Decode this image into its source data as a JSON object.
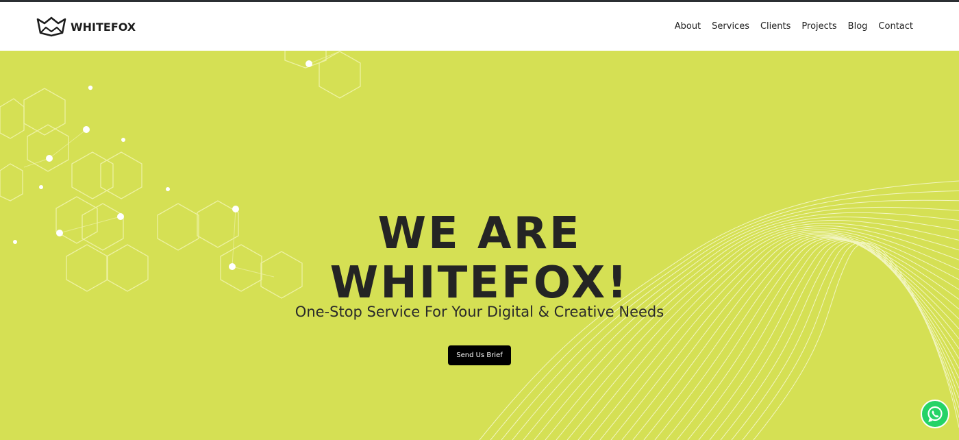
{
  "header": {
    "logo_text": "WHITEFOX",
    "nav": [
      {
        "label": "About"
      },
      {
        "label": "Services"
      },
      {
        "label": "Clients"
      },
      {
        "label": "Projects"
      },
      {
        "label": "Blog"
      },
      {
        "label": "Contact"
      }
    ]
  },
  "hero": {
    "title_line1": "WE ARE",
    "title_line2": "WHITEFOX!",
    "subtitle": "One-Stop Service For Your Digital & Creative Needs",
    "cta_label": "Send Us Brief",
    "background_color": "#d5e054"
  },
  "floating": {
    "whatsapp_icon": "whatsapp-icon",
    "whatsapp_color": "#25d366"
  },
  "colors": {
    "text_dark": "#242424",
    "button_bg": "#000000",
    "button_text": "#ffffff"
  }
}
